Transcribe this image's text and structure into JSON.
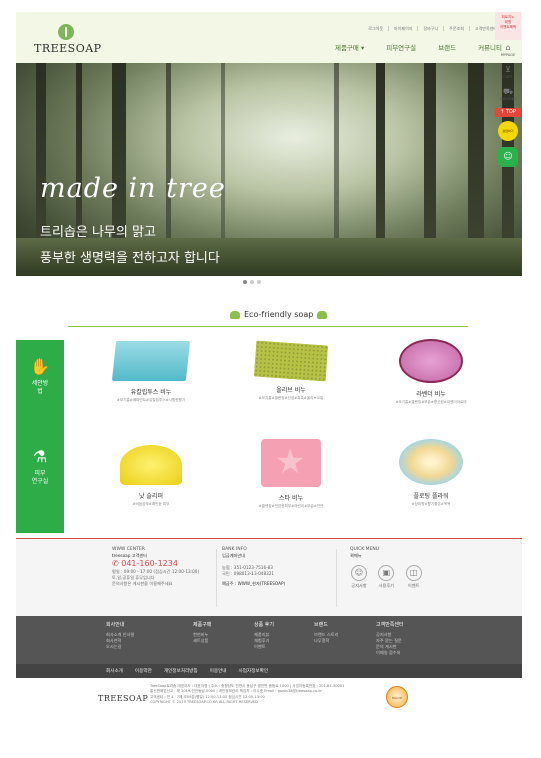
{
  "header": {
    "logo_text": "TREESOAP",
    "util_links": [
      "로그아웃",
      "마이페이지",
      "장바구니",
      "주문조회",
      "고객만족센터"
    ],
    "gnb": [
      "제품구매 ▾",
      "피부연구실",
      "브랜드",
      "커뮤니티"
    ]
  },
  "quick_bar": {
    "event_text": [
      "피로지노",
      "회원",
      "이벤트혜택"
    ],
    "mypage": "MYPAGE",
    "cart": "CART",
    "tracking": "TRACKING",
    "top": "↑ TOP",
    "kakao": "상담하기"
  },
  "hero": {
    "title": "made in tree",
    "sub1": "트리솝은 나무의 맑고",
    "sub2": "풍부한 생명력을 전하고자 합니다"
  },
  "eco": {
    "title": "Eco-friendly soap"
  },
  "side_panel": {
    "item1": [
      "세안방",
      "법"
    ],
    "item2": [
      "피부",
      "연구실"
    ]
  },
  "products": [
    {
      "name": "유칼립투스 비누",
      "tags": "#모기흡#페퍼민트#유칼립투스#시원한향기"
    },
    {
      "name": "올리브 비누",
      "tags": "#모기흡#클렌징#건성#촉촉#올리브오일"
    },
    {
      "name": "라벤더 비누",
      "tags": "#모기흡#클렌징#보습#향긋한#라벤더아로마"
    },
    {
      "name": "낫 슬리퍼",
      "tags": "#비듬샴푸#예민한 피부"
    },
    {
      "name": "스타 비누",
      "tags": "#클렌징#민감한피부#어린이#보습#천연"
    },
    {
      "name": "플로팅 플라워",
      "tags": "#장미향#향기좋은#목욕"
    }
  ],
  "footer_info": {
    "center_h": "WWW CENTER",
    "center_sub": "treesoap 고객센터",
    "tel": "041-160-1234",
    "hours": [
      "평일 : 09:00 - 17:00 (점심시간 12:00-13:00)",
      "토,일,공휴일 휴무입니다",
      "문의사항은 게시판을 이용해주세요"
    ],
    "bank_h": "BANK INFO",
    "bank_sub": "입금계좌안내",
    "bank_lines": [
      "농협 : 351-0123-7516-83",
      "국민 : 098013-13-048321",
      "예금주 : WWW_현자(TREESOAP)"
    ],
    "quick_h": "QUICK MENU",
    "quick_sub": "퀵메뉴",
    "quick_items": [
      "공지사항",
      "사용후기",
      "이벤트"
    ]
  },
  "footer_menu": {
    "cols": [
      {
        "h": "회사안내",
        "items": [
          "회사소개 인사말",
          "회사연혁",
          "오시는길"
        ]
      },
      {
        "h": "제품구매",
        "items": [
          "천연비누",
          "세트상품"
        ]
      },
      {
        "h": "상품 후기",
        "items": [
          "제품리뷰",
          "체험후기",
          "이벤트"
        ]
      },
      {
        "h": "브랜드",
        "items": [
          "브랜드 스토리",
          "나무철학"
        ]
      },
      {
        "h": "고객만족센터",
        "items": [
          "공지사항",
          "자주 묻는 질문",
          "문의 게시판",
          "이메일 접수처"
        ]
      }
    ],
    "bar": [
      "회사소개",
      "이용약관",
      "개인정보처리방침",
      "이용안내",
      "사업자정보확인"
    ]
  },
  "footer_bottom": {
    "logo": "TREESOAP",
    "lines": [
      "TreeSoap트리솝 대표이사 : 대표자명 | 주소 : 충청남도 천안시 동남구 병천면 종합로 1000 | 사업자등록번호 : 201-81-30001",
      "통신판매업신고 : 제 2019-천안동남-0000 | 개인정보관리 책임자 : 이수호 Email : gowls38@treesoap.co.kr",
      "고객센터 : 전 4ㆍ7에 오09분(평일) 12:00-13:00 점심시간 12:00-13:00",
      "COPYRIGHT © 2019 TREESOAP.CO.KR ALL RIGHT RESERVED"
    ],
    "badge": "HACCP"
  }
}
